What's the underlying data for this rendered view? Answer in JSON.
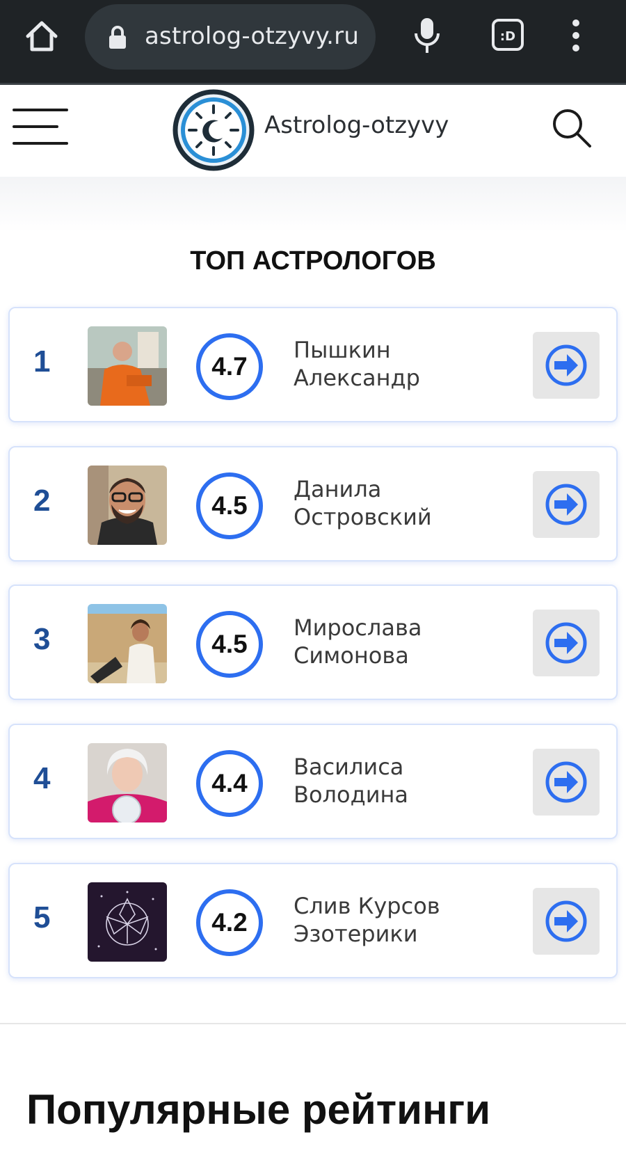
{
  "browser": {
    "url": "astrolog-otzyvy.ru",
    "icons": [
      "home-icon",
      "lock-icon",
      "mic-icon",
      "tabs-icon",
      "more-vert-icon"
    ]
  },
  "site": {
    "logo_text": "Astrolog-otzyvy",
    "icons": [
      "hamburger-icon",
      "logo-icon",
      "search-icon"
    ]
  },
  "top_section": {
    "title": "ТОП АСТРОЛОГОВ",
    "items": [
      {
        "rank": "1",
        "score": "4.7",
        "name_line1": "Пышкин",
        "name_line2": "Александр"
      },
      {
        "rank": "2",
        "score": "4.5",
        "name_line1": "Данила",
        "name_line2": "Островский"
      },
      {
        "rank": "3",
        "score": "4.5",
        "name_line1": "Мирослава",
        "name_line2": "Симонова"
      },
      {
        "rank": "4",
        "score": "4.4",
        "name_line1": "Василиса",
        "name_line2": "Володина"
      },
      {
        "rank": "5",
        "score": "4.2",
        "name_line1": "Слив Курсов",
        "name_line2": "Эзотерики"
      }
    ]
  },
  "popular": {
    "title": "Популярные рейтинги"
  },
  "colors": {
    "accent": "#2d6ef0",
    "rank": "#1f4e96",
    "browser_bg": "#1f2326"
  }
}
